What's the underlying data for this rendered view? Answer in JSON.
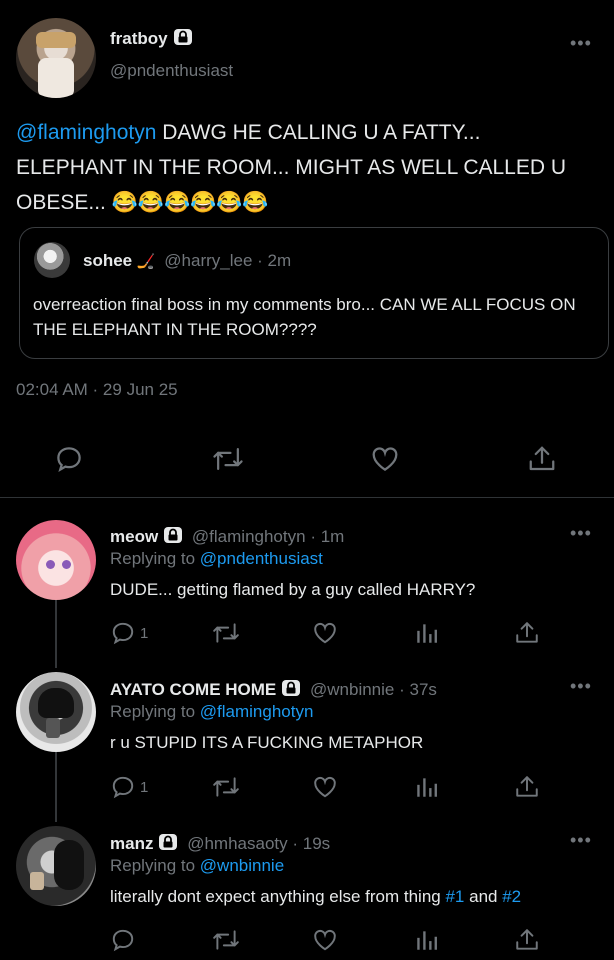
{
  "main_tweet": {
    "display_name": "fratboy",
    "handle": "@pndenthusiast",
    "mention": "@flaminghotyn",
    "text": " DAWG HE CALLING U A FATTY... ELEPHANT IN THE ROOM... MIGHT AS WELL CALLED U OBESE... 😂😂😂😂😂😂",
    "timestamp": "02:04 AM · 29 Jun 25",
    "quote": {
      "display_name": "sohee",
      "emoji": "🏒",
      "handle": "@harry_lee",
      "time": "· 2m",
      "text": "overreaction final boss in my comments bro... CAN WE ALL FOCUS ON THE ELEPHANT IN THE ROOM????"
    }
  },
  "replies": [
    {
      "display_name": "meow",
      "handle": "@flaminghotyn",
      "time": "· 1m",
      "replying_prefix": "Replying to ",
      "replying_to": "@pndenthusiast",
      "text": "DUDE... getting flamed by a guy called HARRY?",
      "reply_count": "1"
    },
    {
      "display_name": "AYATO COME HOME",
      "handle": "@wnbinnie",
      "time": "· 37s",
      "replying_prefix": "Replying to ",
      "replying_to": "@flaminghotyn",
      "text": "r u STUPID ITS A FUCKING METAPHOR",
      "reply_count": "1"
    },
    {
      "display_name": "manz",
      "handle": "@hmhasaoty",
      "time": "· 19s",
      "replying_prefix": "Replying to ",
      "replying_to": "@wnbinnie",
      "text_before": "literally dont expect anything else from thing ",
      "hashtag1": "#1",
      "text_mid": " and ",
      "hashtag2": "#2",
      "reply_count": ""
    }
  ],
  "icons": {
    "more": "more-horizontal-icon",
    "lock": "lock-icon",
    "reply": "reply-bubble-icon",
    "retweet": "retweet-icon",
    "like": "heart-icon",
    "views": "views-bar-icon",
    "share": "share-upload-icon"
  },
  "colors": {
    "background": "#000000",
    "text": "#e7e9ea",
    "muted": "#71767b",
    "link": "#1d9bf0"
  }
}
